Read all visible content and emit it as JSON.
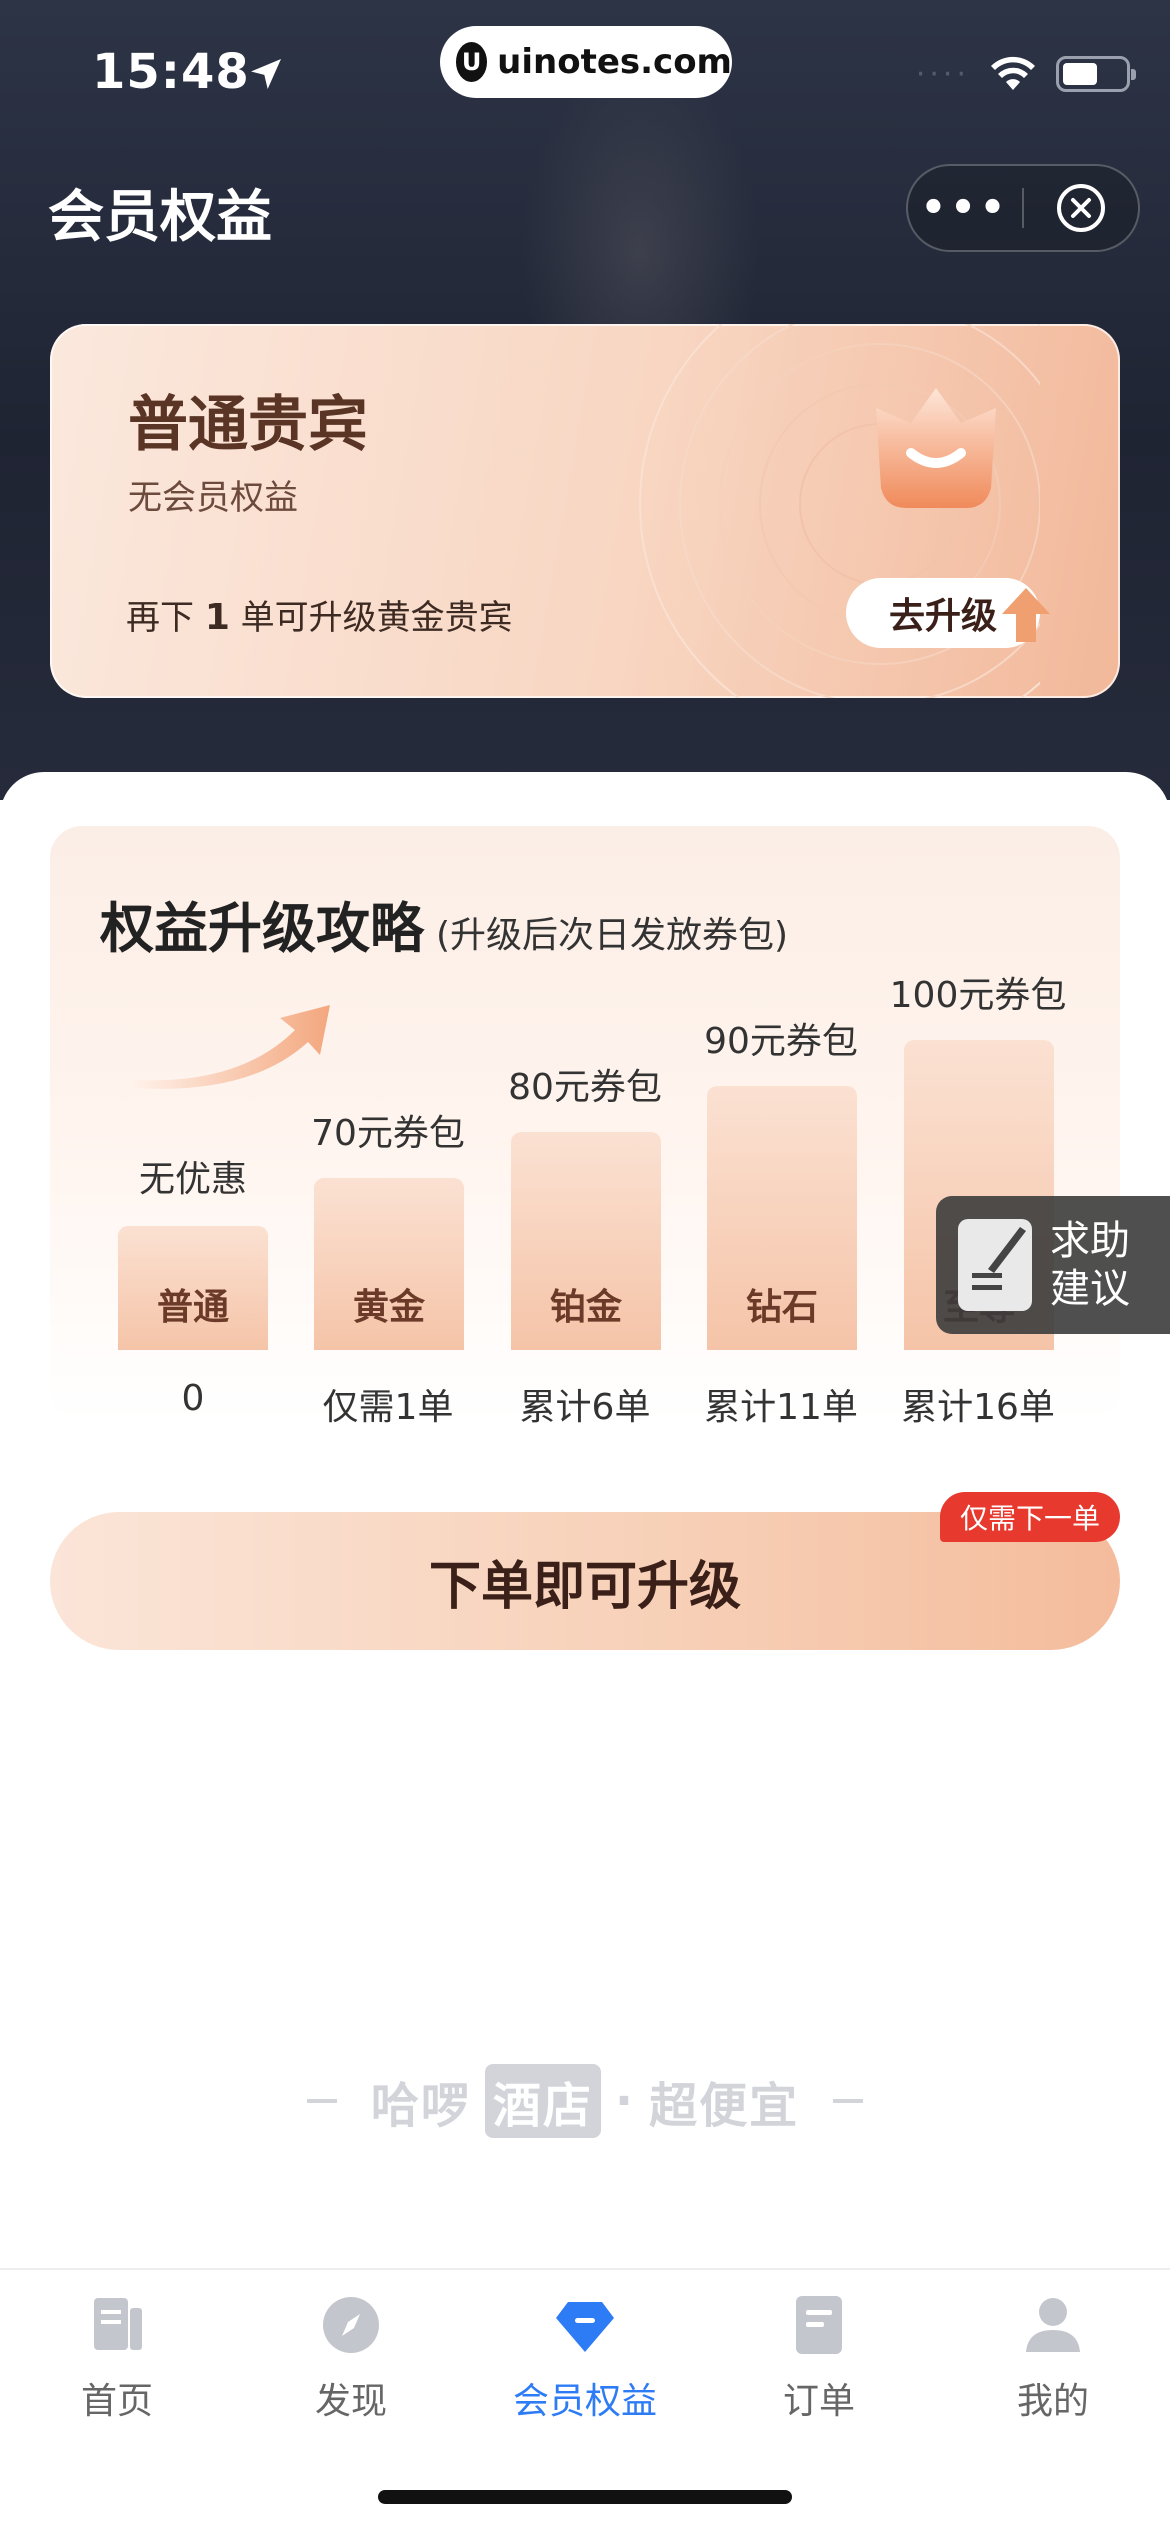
{
  "status_bar": {
    "time": "15:48",
    "url": "uinotes.com",
    "url_logo": "U"
  },
  "header": {
    "title": "会员权益",
    "more_label": "•••"
  },
  "member_card": {
    "level": "普通贵宾",
    "benefits": "无会员权益",
    "hint_prefix": "再下 ",
    "hint_count": "1",
    "hint_suffix": " 单可升级黄金贵宾",
    "upgrade_label": "去升级"
  },
  "strategy": {
    "title": "权益升级攻略",
    "note": "(升级后次日发放券包)",
    "tiers": [
      {
        "name": "普通",
        "reward": "无优惠",
        "condition": "0"
      },
      {
        "name": "黄金",
        "reward": "70元券包",
        "condition": "仅需1单"
      },
      {
        "name": "铂金",
        "reward": "80元券包",
        "condition": "累计6单"
      },
      {
        "name": "钻石",
        "reward": "90元券包",
        "condition": "累计11单"
      },
      {
        "name": "至尊",
        "reward": "100元券包",
        "condition": "累计16单"
      }
    ]
  },
  "help": {
    "label": "求助建议"
  },
  "cta": {
    "label": "下单即可升级",
    "badge": "仅需下一单"
  },
  "slogan": {
    "brand": "哈啰",
    "hotel": "酒店",
    "dot": "·",
    "tagline": "超便宜"
  },
  "tabs": [
    {
      "label": "首页",
      "icon": "book-icon"
    },
    {
      "label": "发现",
      "icon": "compass-icon"
    },
    {
      "label": "会员权益",
      "icon": "diamond-icon",
      "active": true
    },
    {
      "label": "订单",
      "icon": "order-icon"
    },
    {
      "label": "我的",
      "icon": "user-icon"
    }
  ],
  "colors": {
    "accent": "#2d7cf6",
    "badge": "#e8392e",
    "brown": "#5a3526"
  }
}
